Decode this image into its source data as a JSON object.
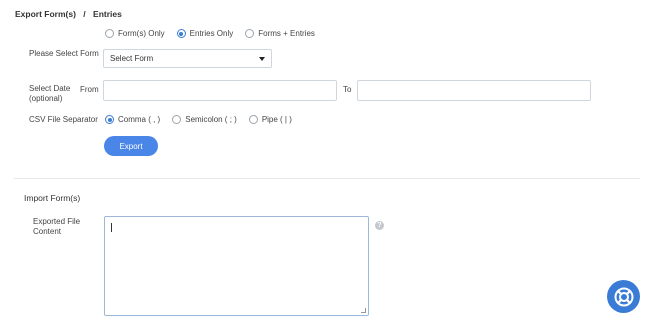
{
  "export": {
    "title_part1": "Export Form(s)",
    "title_sep": "/",
    "title_part2": "Entries",
    "type_options": [
      {
        "label": "Form(s) Only",
        "checked": false
      },
      {
        "label": "Entries Only",
        "checked": true
      },
      {
        "label": "Forms + Entries",
        "checked": false
      }
    ],
    "select_form_label": "Please Select Form",
    "select_form_value": "Select Form",
    "select_date_label_1": "Select Date",
    "select_date_label_2": "(optional)",
    "from_label": "From",
    "to_label": "To",
    "csv_label": "CSV File Separator",
    "separator_options": [
      {
        "label": "Comma ( , )",
        "checked": true
      },
      {
        "label": "Semicolon ( ; )",
        "checked": false
      },
      {
        "label": "Pipe ( | )",
        "checked": false
      }
    ],
    "export_button": "Export"
  },
  "import": {
    "title": "Import Form(s)",
    "content_label_1": "Exported File",
    "content_label_2": "Content",
    "help_glyph": "?"
  },
  "accent_color": "#4a86e8",
  "icons": {
    "help": "question-circle-icon",
    "support": "lifebuoy-icon"
  }
}
